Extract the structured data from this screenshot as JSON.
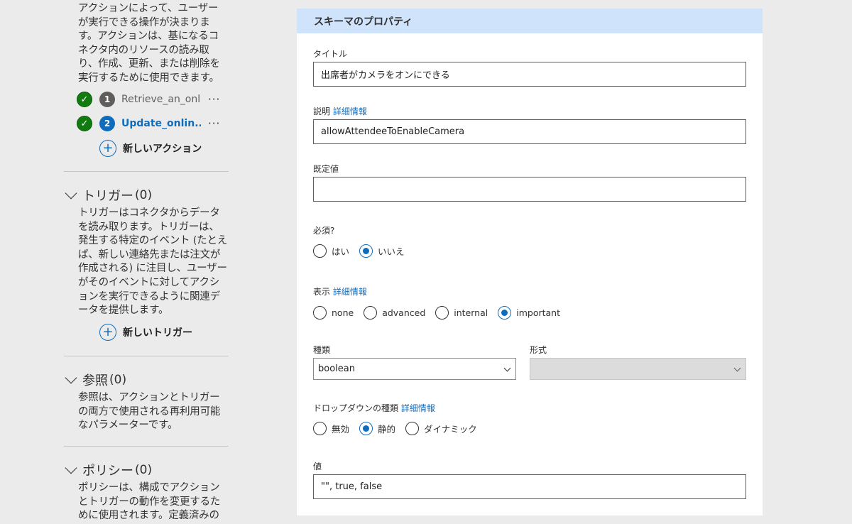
{
  "left": {
    "actions_desc": [
      "アクションによって、ユーザー",
      "が実行できる操作が決まりま",
      "す。アクションは、基になるコ",
      "ネクタ内のリソースの読み取",
      "り、作成、更新、または削除を",
      "実行するために使用できます。"
    ],
    "actions": [
      {
        "number": "1",
        "label": "Retrieve_an_onl...",
        "more": "···"
      },
      {
        "number": "2",
        "label": "Update_onlin...",
        "more": "···"
      }
    ],
    "new_action": "新しいアクション",
    "triggers": {
      "title": "トリガー",
      "count": "(0)",
      "desc": [
        "トリガーはコネクタからデータ",
        "を読み取ります。トリガーは、",
        "発生する特定のイベント (たとえ",
        "ば、新しい連絡先または注文が",
        "作成される) に注目し、ユーザー",
        "がそのイベントに対してアクシ",
        "ョンを実行できるように関連デ",
        "ータを提供します。"
      ],
      "new_label": "新しいトリガー"
    },
    "references": {
      "title": "参照",
      "count": "(0)",
      "desc": [
        "参照は、アクションとトリガー",
        "の両方で使用される再利用可能",
        "なパラメーターです。"
      ]
    },
    "policies": {
      "title": "ポリシー",
      "count": "(0)",
      "desc": [
        "ポリシーは、構成でアクション",
        "とトリガーの動作を変更するた",
        "めに使用されます。定義済みの"
      ]
    }
  },
  "form": {
    "header": "スキーマのプロパティ",
    "title_label": "タイトル",
    "title_value": "出席者がカメラをオンにできる",
    "desc_label": "説明",
    "more_info": "詳細情報",
    "desc_value": "allowAttendeeToEnableCamera",
    "default_label": "既定値",
    "default_value": "",
    "required_label": "必須?",
    "required_options": [
      "はい",
      "いいえ"
    ],
    "required_selected": 1,
    "visibility_label": "表示",
    "visibility_options": [
      "none",
      "advanced",
      "internal",
      "important"
    ],
    "visibility_selected": 3,
    "type_label": "種類",
    "type_value": "boolean",
    "format_label": "形式",
    "format_value": "",
    "dropdown_label": "ドロップダウンの種類",
    "dropdown_options": [
      "無効",
      "静的",
      "ダイナミック"
    ],
    "dropdown_selected": 1,
    "values_label": "値",
    "values_value": "\"\", true, false"
  },
  "colors": {
    "accent": "#0f6cbd",
    "check_green": "#107c10",
    "header_bg": "#cfe4fa",
    "page_bg": "#ebebeb"
  }
}
